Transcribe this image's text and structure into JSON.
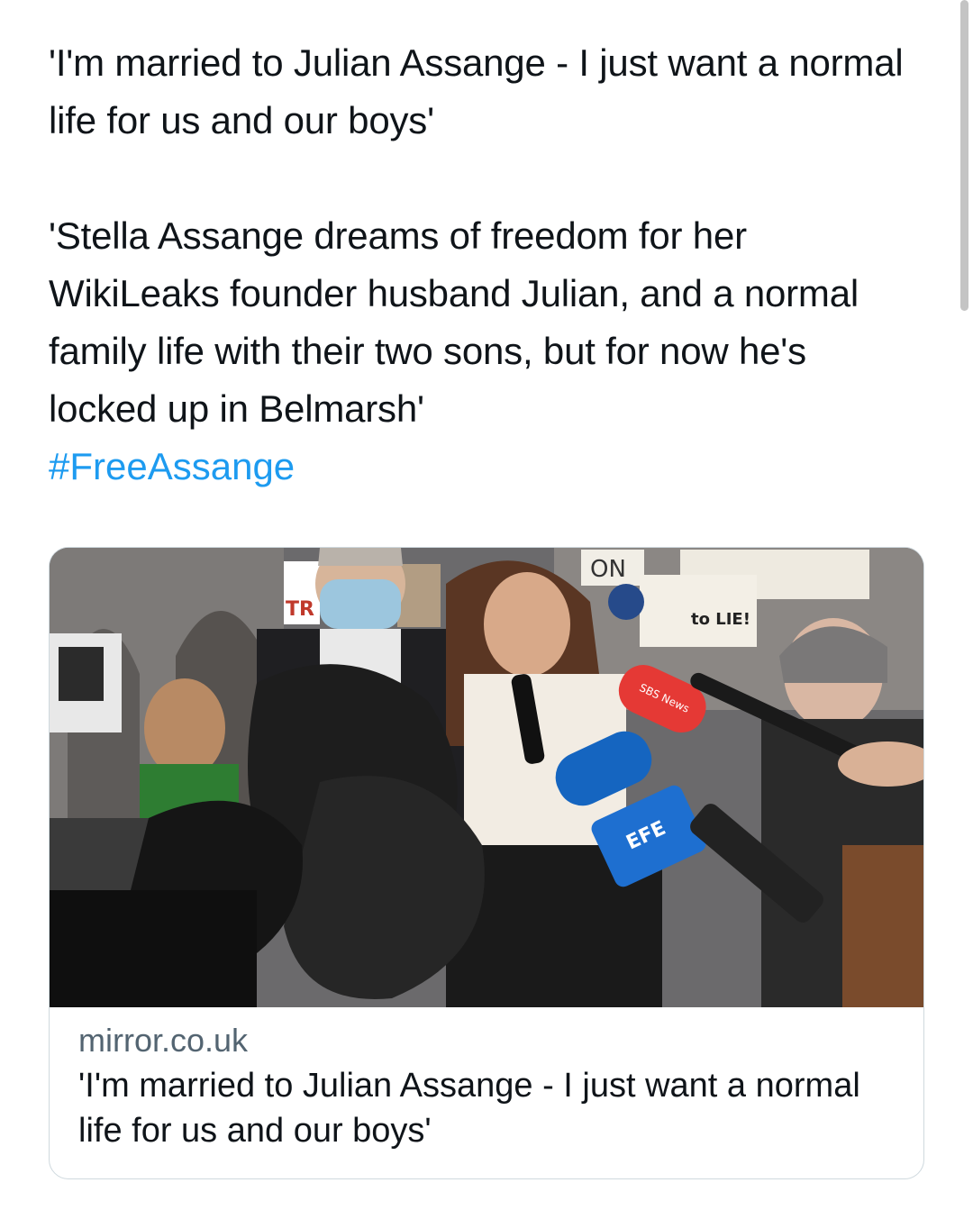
{
  "tweet": {
    "paragraph1": "'I'm married to Julian Assange - I just want a normal life for us and our boys'",
    "paragraph2": "'Stella Assange dreams of freedom for her WikiLeaks founder husband Julian, and a normal family life with their two sons, but for now he's locked up in Belmarsh'",
    "hashtag": "#FreeAssange"
  },
  "card": {
    "image_signs": {
      "sign_on": "ON",
      "sign_lie": "to LIE!",
      "sign_lettering": "TR",
      "mic_sbs": "SBS News",
      "mic_efe": "EFE"
    },
    "domain": "mirror.co.uk",
    "title": "'I'm married to Julian Assange - I just want a normal life for us and our boys'"
  },
  "colors": {
    "hashtag": "#1d9bf0",
    "domain": "#536471",
    "border": "#cfd9de"
  }
}
